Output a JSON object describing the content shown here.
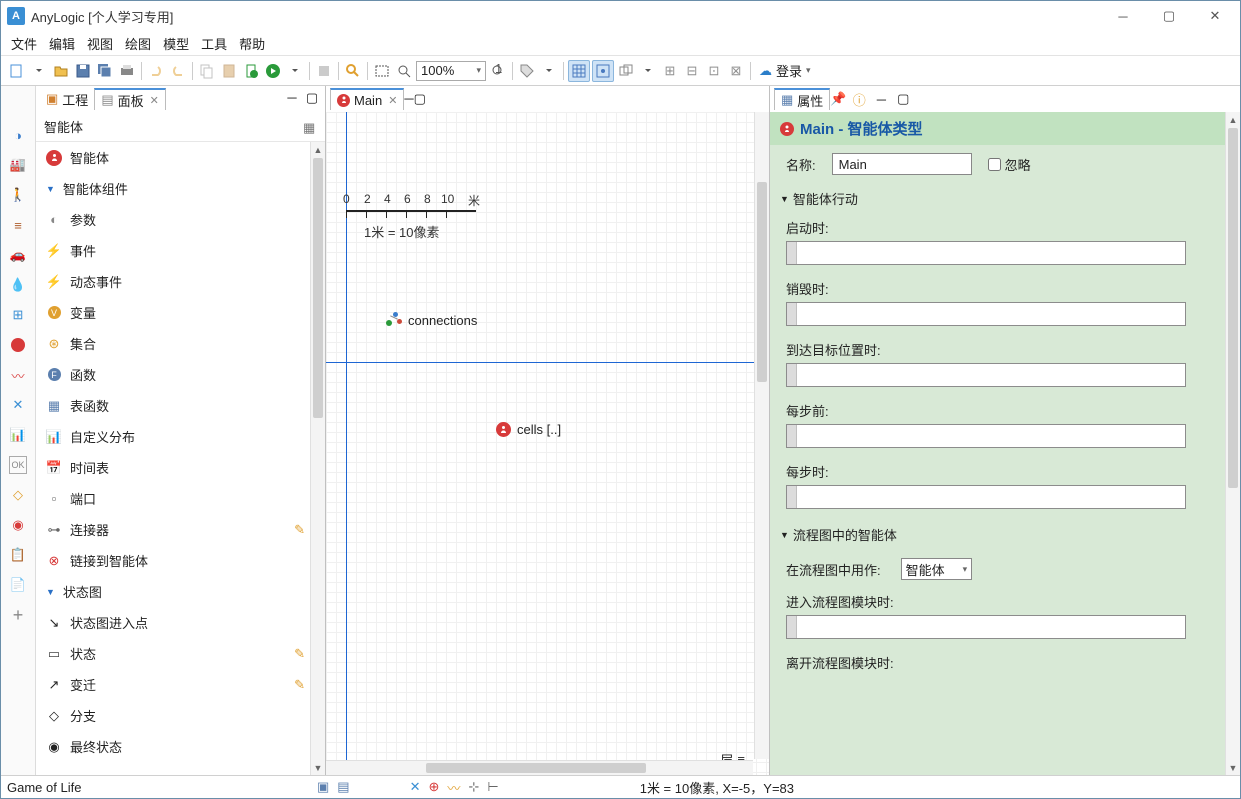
{
  "title": "AnyLogic [个人学习专用]",
  "menu": [
    "文件",
    "编辑",
    "视图",
    "绘图",
    "模型",
    "工具",
    "帮助"
  ],
  "zoom": "100%",
  "login": "登录",
  "left_tabs": {
    "projects": "工程",
    "palette": "面板"
  },
  "palette_title": "智能体",
  "palette": {
    "agent": "智能体",
    "section_components": "智能体组件",
    "items1": [
      "参数",
      "事件",
      "动态事件",
      "变量",
      "集合",
      "函数",
      "表函数",
      "自定义分布",
      "时间表",
      "端口",
      "连接器",
      "链接到智能体"
    ],
    "section_statechart": "状态图",
    "items2": [
      "状态图进入点",
      "状态",
      "变迁",
      "分支",
      "最终状态"
    ]
  },
  "editor": {
    "tab": "Main",
    "scale_numbers": [
      "0",
      "2",
      "4",
      "6",
      "8",
      "10"
    ],
    "scale_unit": "米",
    "scale_label": "1米 = 10像素",
    "connections_label": "connections",
    "cells_label": "cells [..]",
    "layers_label": "层"
  },
  "properties": {
    "tab": "属性",
    "title": "Main - 智能体类型",
    "name_label": "名称:",
    "name_value": "Main",
    "ignore_label": "忽略",
    "sec_actions": "智能体行动",
    "fields_actions": [
      "启动时:",
      "销毁时:",
      "到达目标位置时:",
      "每步前:",
      "每步时:"
    ],
    "sec_flowchart": "流程图中的智能体",
    "use_as_label": "在流程图中用作:",
    "use_as_value": "智能体",
    "fields_flow": [
      "进入流程图模块时:",
      "离开流程图模块时:"
    ]
  },
  "status": {
    "project": "Game of Life",
    "coords": "1米 = 10像素, X=-5，Y=83"
  }
}
